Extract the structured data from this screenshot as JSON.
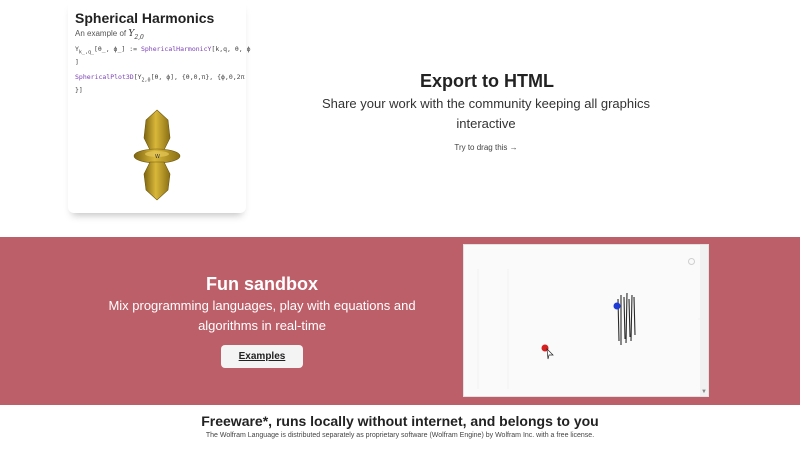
{
  "notebook": {
    "title": "Spherical Harmonics",
    "subtitle_prefix": "An example of ",
    "subtitle_math": "Y",
    "subtitle_math_sub": "2,0",
    "code_line1a": "Y",
    "code_line1a_sub": "k_,q_",
    "code_line1b": "[θ_, ϕ_] := ",
    "code_line1fn": "SphericalHarmonicY",
    "code_line1c": "[k,q, θ, ϕ",
    "code_line1d": "]",
    "code_line2fn": "SphericalPlot3D",
    "code_line2a": "[Y",
    "code_line2a_sub": "2,0",
    "code_line2b": "[θ, ϕ], {θ,0,π}, {ϕ,0,2π",
    "code_line2c": "}]",
    "plot_icon": "spherical-harmonic-3d-plot",
    "plot_color": "#c8a62a"
  },
  "export": {
    "title": "Export to HTML",
    "description": "Share your work with the community keeping all graphics interactive",
    "drag_hint": "Try to drag this →"
  },
  "sandbox": {
    "title": "Fun sandbox",
    "description": "Mix programming languages, play with equations and algorithms in real-time",
    "button_label": "Examples",
    "background": "#bd5f69",
    "red_dot_color": "#d62020",
    "blue_dot_color": "#1f3bd6"
  },
  "footer": {
    "title": "Freeware*, runs locally without internet, and belongs to you",
    "note": "The Wolfram Language is distributed separately as proprietary software (Wolfram Engine) by Wolfram Inc. with a free license."
  }
}
